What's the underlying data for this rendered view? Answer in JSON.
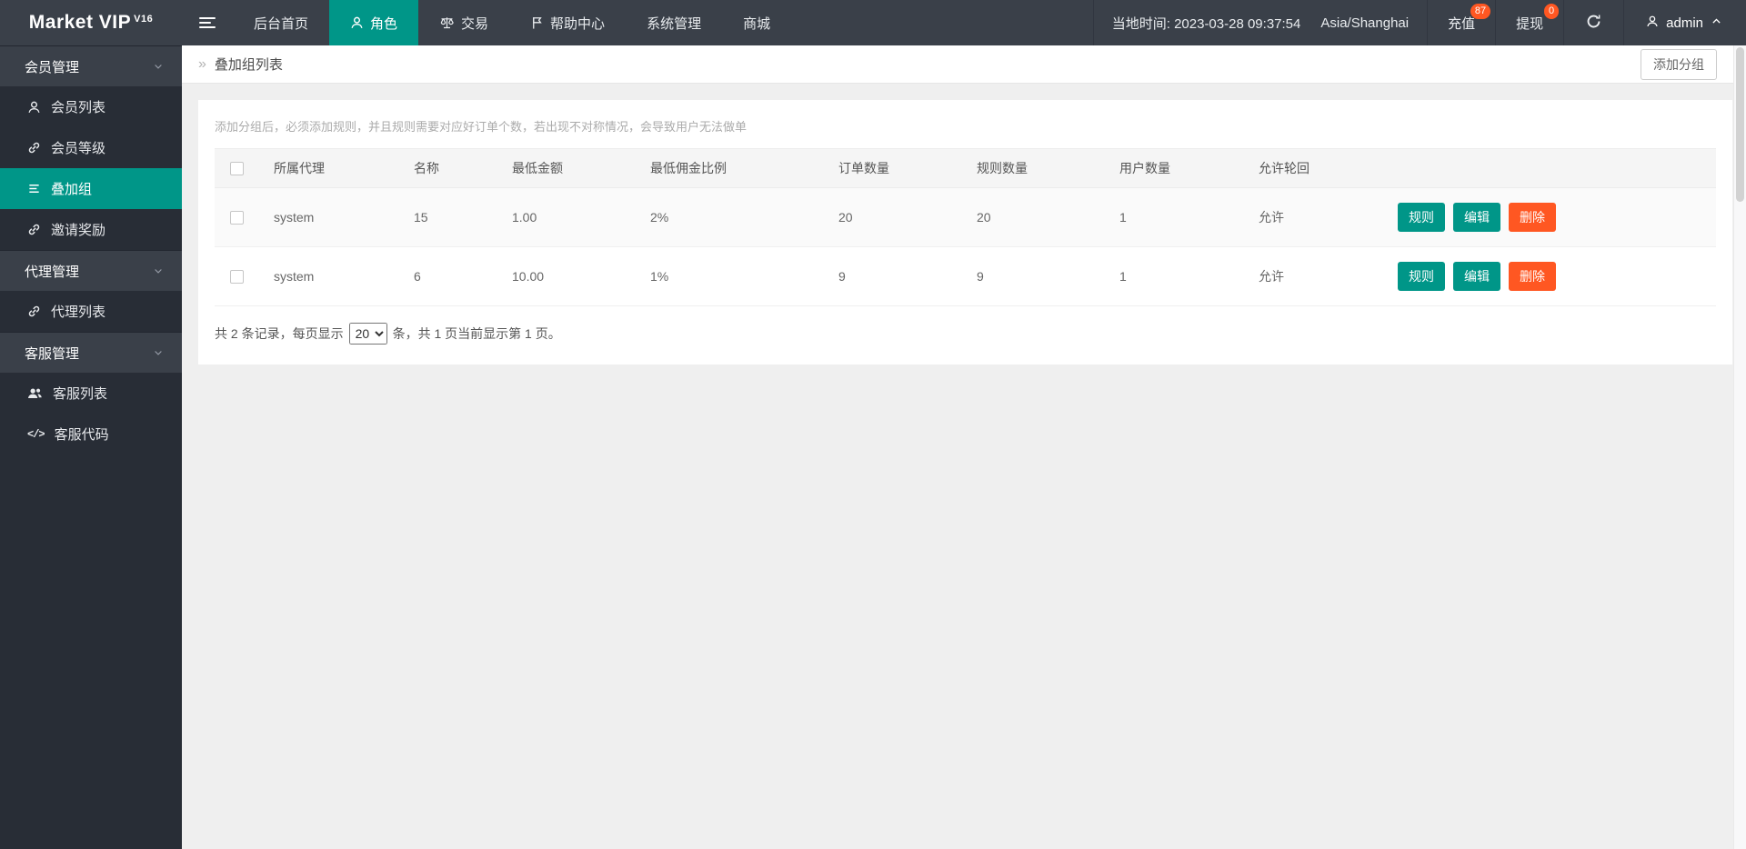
{
  "colors": {
    "accent": "#009688",
    "danger": "#ff5722",
    "navbar_bg": "#3a4049",
    "sidebar_bg": "#282d36"
  },
  "navbar": {
    "brand": "Market VIP",
    "brand_version": "V16",
    "items": [
      {
        "label": "后台首页"
      },
      {
        "label": "角色",
        "active": true,
        "icon": "user-icon"
      },
      {
        "label": "交易",
        "icon": "scales-icon"
      },
      {
        "label": "帮助中心",
        "icon": "flag-icon"
      },
      {
        "label": "系统管理"
      },
      {
        "label": "商城"
      }
    ],
    "local_time": "当地时间: 2023-03-28 09:37:54",
    "timezone": "Asia/Shanghai",
    "recharge": {
      "label": "充值",
      "badge": "87"
    },
    "withdraw": {
      "label": "提现",
      "badge": "0"
    },
    "user": "admin"
  },
  "sidebar": {
    "sections": [
      {
        "title": "会员管理",
        "items": [
          {
            "label": "会员列表",
            "icon": "user-icon"
          },
          {
            "label": "会员等级",
            "icon": "link-icon"
          },
          {
            "label": "叠加组",
            "icon": "list-icon",
            "active": true
          },
          {
            "label": "邀请奖励",
            "icon": "link-icon"
          }
        ]
      },
      {
        "title": "代理管理",
        "items": [
          {
            "label": "代理列表",
            "icon": "link-icon"
          }
        ]
      },
      {
        "title": "客服管理",
        "items": [
          {
            "label": "客服列表",
            "icon": "users-icon"
          },
          {
            "label": "客服代码",
            "icon": "code-icon",
            "glyph": "</>"
          }
        ]
      }
    ]
  },
  "breadcrumb": {
    "icon": "»",
    "title": "叠加组列表",
    "add_button": "添加分组"
  },
  "main": {
    "hint": "添加分组后，必须添加规则，并且规则需要对应好订单个数，若出现不对称情况，会导致用户无法做单",
    "table": {
      "headers": [
        "所属代理",
        "名称",
        "最低金额",
        "最低佣金比例",
        "订单数量",
        "规则数量",
        "用户数量",
        "允许轮回"
      ],
      "rows": [
        [
          "system",
          "15",
          "1.00",
          "2%",
          "20",
          "20",
          "1",
          "允许"
        ],
        [
          "system",
          "6",
          "10.00",
          "1%",
          "9",
          "9",
          "1",
          "允许"
        ]
      ],
      "actions": {
        "rule": "规则",
        "edit": "编辑",
        "delete": "删除"
      }
    },
    "pagination": {
      "prefix": "共 2 条记录，每页显示",
      "page_size": "20",
      "suffix": "条，共 1 页当前显示第 1 页。"
    }
  }
}
